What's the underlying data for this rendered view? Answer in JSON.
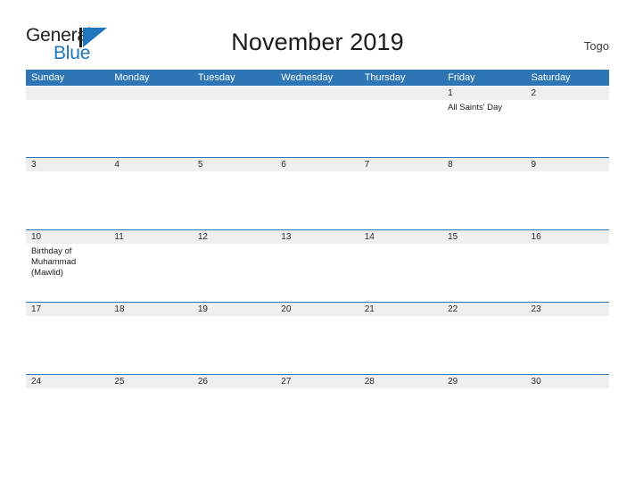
{
  "brand": {
    "name_top": "General",
    "name_bottom": "Blue",
    "mark": "triangle-logo",
    "colors": {
      "blue": "#1f76bc",
      "dark": "#231f20"
    }
  },
  "header": {
    "title": "November 2019",
    "country": "Togo"
  },
  "theme": {
    "header_blue": "#2e75b6",
    "date_band": "#efefef",
    "rule": "#2e75b6"
  },
  "calendar": {
    "weekdays": [
      "Sunday",
      "Monday",
      "Tuesday",
      "Wednesday",
      "Thursday",
      "Friday",
      "Saturday"
    ],
    "weeks": [
      {
        "days": [
          {
            "date": "",
            "events": []
          },
          {
            "date": "",
            "events": []
          },
          {
            "date": "",
            "events": []
          },
          {
            "date": "",
            "events": []
          },
          {
            "date": "",
            "events": []
          },
          {
            "date": "1",
            "events": [
              "All Saints' Day"
            ]
          },
          {
            "date": "2",
            "events": []
          }
        ]
      },
      {
        "days": [
          {
            "date": "3",
            "events": []
          },
          {
            "date": "4",
            "events": []
          },
          {
            "date": "5",
            "events": []
          },
          {
            "date": "6",
            "events": []
          },
          {
            "date": "7",
            "events": []
          },
          {
            "date": "8",
            "events": []
          },
          {
            "date": "9",
            "events": []
          }
        ]
      },
      {
        "days": [
          {
            "date": "10",
            "events": [
              "Birthday of Muhammad (Mawlid)"
            ]
          },
          {
            "date": "11",
            "events": []
          },
          {
            "date": "12",
            "events": []
          },
          {
            "date": "13",
            "events": []
          },
          {
            "date": "14",
            "events": []
          },
          {
            "date": "15",
            "events": []
          },
          {
            "date": "16",
            "events": []
          }
        ]
      },
      {
        "days": [
          {
            "date": "17",
            "events": []
          },
          {
            "date": "18",
            "events": []
          },
          {
            "date": "19",
            "events": []
          },
          {
            "date": "20",
            "events": []
          },
          {
            "date": "21",
            "events": []
          },
          {
            "date": "22",
            "events": []
          },
          {
            "date": "23",
            "events": []
          }
        ]
      },
      {
        "days": [
          {
            "date": "24",
            "events": []
          },
          {
            "date": "25",
            "events": []
          },
          {
            "date": "26",
            "events": []
          },
          {
            "date": "27",
            "events": []
          },
          {
            "date": "28",
            "events": []
          },
          {
            "date": "29",
            "events": []
          },
          {
            "date": "30",
            "events": []
          }
        ]
      }
    ]
  }
}
